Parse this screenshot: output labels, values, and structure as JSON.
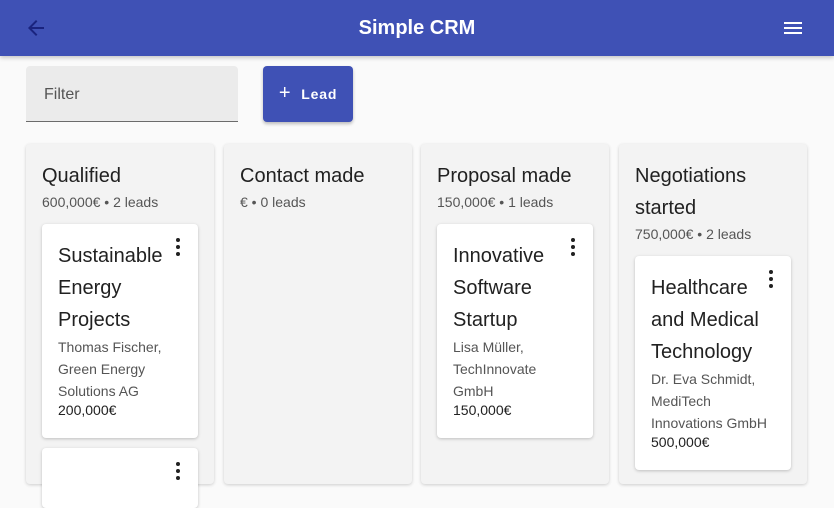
{
  "appbar": {
    "title": "Simple CRM",
    "back_icon": "arrow-back-icon",
    "menu_icon": "menu-icon"
  },
  "toolbar": {
    "filter_placeholder": "Filter",
    "lead_button_label": "Lead",
    "lead_button_icon": "+"
  },
  "columns": [
    {
      "title": "Qualified",
      "meta": "600,000€ • 2 leads",
      "cards": [
        {
          "title": "Sustainable Energy Projects",
          "contact": "Thomas Fischer, Green Energy Solutions AG",
          "value": "200,000€"
        }
      ]
    },
    {
      "title": "Contact made",
      "meta": "€ • 0 leads",
      "cards": []
    },
    {
      "title": "Proposal made",
      "meta": "150,000€ • 1 leads",
      "cards": [
        {
          "title": "Innovative Software Startup",
          "contact": "Lisa Müller, TechInnovate GmbH",
          "value": "150,000€"
        }
      ]
    },
    {
      "title": "Negotiations started",
      "meta": "750,000€ • 2 leads",
      "cards": [
        {
          "title": "Healthcare and Medical Technology",
          "contact": "Dr. Eva Schmidt, MediTech Innovations GmbH",
          "value": "500,000€"
        }
      ]
    }
  ],
  "colors": {
    "primary": "#3f51b5",
    "background": "#fafafa",
    "column": "#f3f3f3"
  }
}
